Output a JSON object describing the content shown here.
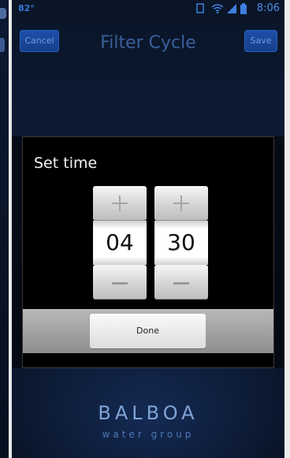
{
  "status_bar": {
    "temperature": "82°",
    "time": "8:06",
    "accent": "#3e7fe0"
  },
  "header": {
    "title": "Filter Cycle",
    "cancel_label": "Cancel",
    "save_label": "Save"
  },
  "dialog": {
    "title": "Set time",
    "hours": "04",
    "minutes": "30",
    "done_label": "Done"
  },
  "branding": {
    "logo_text": "BALBOA",
    "logo_sub": "water group"
  }
}
